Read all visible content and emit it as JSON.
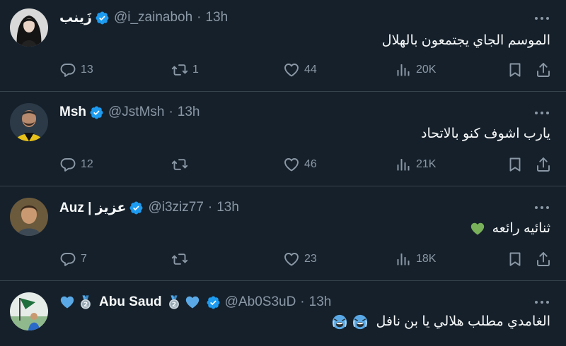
{
  "tweets": [
    {
      "name": "زَينب",
      "handle": "@i_zainaboh",
      "dot": "·",
      "time": "13h",
      "text": "الموسم الجاي  يجتمعون بالهلال",
      "replies": "13",
      "retweets": "1",
      "likes": "44",
      "views": "20K"
    },
    {
      "name": "Msh",
      "handle": "@JstMsh",
      "dot": "·",
      "time": "13h",
      "text": "يارب اشوف كنو بالاتحاد",
      "replies": "12",
      "retweets": "",
      "likes": "46",
      "views": "21K"
    },
    {
      "name": "Auz | عزيز",
      "handle": "@i3ziz77",
      "dot": "·",
      "time": "13h",
      "text": "ثنائيه رائعه",
      "replies": "7",
      "retweets": "",
      "likes": "23",
      "views": "18K"
    },
    {
      "name": "Abu Saud",
      "handle": "@Ab0S3uD",
      "dot": "·",
      "time": "13h",
      "text": "الغامدي مطلب هلالي يا بن نافل"
    }
  ],
  "colors": {
    "background": "#15202b",
    "divider": "#38444d",
    "text": "#f7f9f9",
    "muted": "#8b98a5",
    "verified": "#1d9bf0",
    "heart_blue": "#5aa9e6",
    "heart_green": "#78b159"
  },
  "icons": [
    "verified-badge-icon",
    "more-icon",
    "reply-icon",
    "retweet-icon",
    "like-icon",
    "views-icon",
    "bookmark-icon",
    "share-icon",
    "blue-heart-emoji",
    "silver-medal-emoji",
    "green-heart-emoji",
    "crying-face-emoji"
  ]
}
